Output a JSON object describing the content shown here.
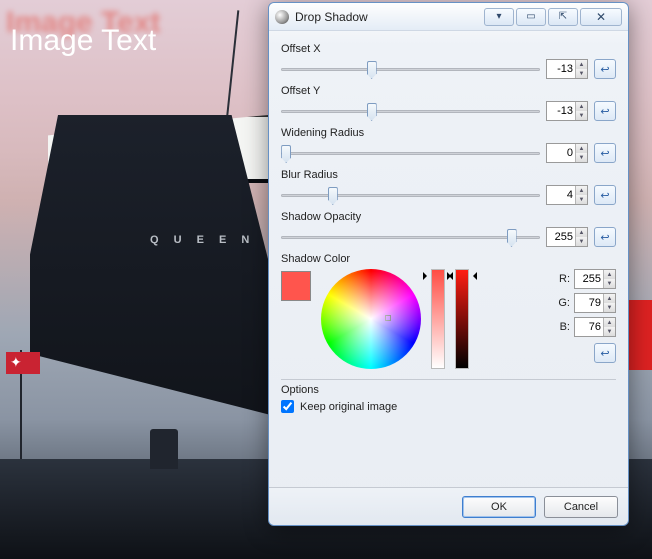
{
  "background": {
    "overlay_text": "Image Text",
    "ship_label": "Q U E E N"
  },
  "dialog": {
    "title": "Drop Shadow",
    "controls": {
      "offset_x": {
        "label": "Offset X",
        "value": "-13",
        "min": -100,
        "max": 100,
        "pos_pct": 35
      },
      "offset_y": {
        "label": "Offset Y",
        "value": "-13",
        "min": -100,
        "max": 100,
        "pos_pct": 35
      },
      "widening": {
        "label": "Widening Radius",
        "value": "0",
        "min": 0,
        "max": 100,
        "pos_pct": 2
      },
      "blur": {
        "label": "Blur Radius",
        "value": "4",
        "min": 0,
        "max": 50,
        "pos_pct": 20
      },
      "opacity": {
        "label": "Shadow Opacity",
        "value": "255",
        "min": 0,
        "max": 255,
        "pos_pct": 89
      }
    },
    "shadow_color": {
      "label": "Shadow Color",
      "swatch_hex": "#ff554d",
      "r": "255",
      "g": "79",
      "b": "76",
      "r_label": "R:",
      "g_label": "G:",
      "b_label": "B:"
    },
    "options": {
      "section_label": "Options",
      "keep_original": {
        "label": "Keep original image",
        "checked": true
      }
    },
    "buttons": {
      "ok": "OK",
      "cancel": "Cancel"
    },
    "reset_glyph": "↩"
  }
}
